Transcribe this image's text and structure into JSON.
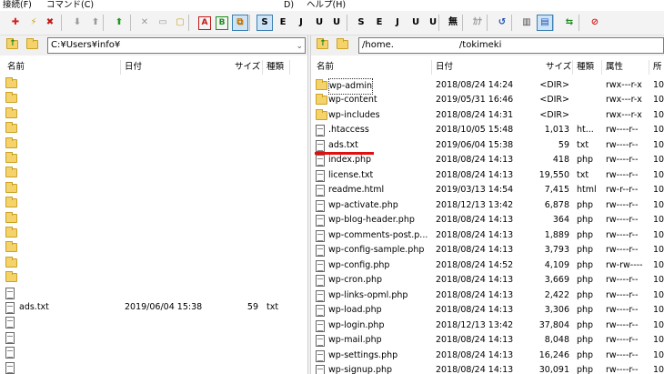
{
  "menu": {
    "items": [
      "接続(F)",
      "コマンド(C)",
      "D)",
      "ヘルプ(H)"
    ]
  },
  "toolbar": {
    "buttons": [
      {
        "icon": "connect-icon",
        "glyph": "✚",
        "color": "#d21f1f"
      },
      {
        "icon": "quick-connect-icon",
        "glyph": "⚡",
        "color": "#d4a000"
      },
      {
        "icon": "disconnect-icon",
        "glyph": "✖",
        "color": "#c01818"
      },
      {
        "icon": "download-icon",
        "glyph": "⬇",
        "color": "#9a9a9a"
      },
      {
        "icon": "upload-icon",
        "glyph": "⬆",
        "color": "#9a9a9a"
      },
      {
        "icon": "mirror-upload-icon",
        "glyph": "⬆",
        "color": "#1f9a1f"
      },
      {
        "icon": "delete-icon",
        "glyph": "✕",
        "color": "#9a9a9a"
      },
      {
        "icon": "rename-icon",
        "glyph": "▭",
        "color": "#9a9a9a"
      },
      {
        "icon": "mkdir-icon",
        "glyph": "▢",
        "color": "#c9a227"
      },
      {
        "icon": "ascii-mode-icon",
        "glyph": "A",
        "color": "#c01818"
      },
      {
        "icon": "binary-mode-icon",
        "glyph": "B",
        "color": "#1f8a1f"
      },
      {
        "icon": "auto-mode-icon",
        "glyph": "⧉",
        "color": "#c07000"
      },
      {
        "icon": "sjis-remote-icon",
        "glyph": "S",
        "color": "#000"
      },
      {
        "icon": "euc-remote-icon",
        "glyph": "E",
        "color": "#000"
      },
      {
        "icon": "jis-remote-icon",
        "glyph": "J",
        "color": "#000"
      },
      {
        "icon": "utf8n-remote-icon",
        "glyph": "U",
        "color": "#000"
      },
      {
        "icon": "utf8-remote-icon",
        "glyph": "U",
        "color": "#000"
      },
      {
        "icon": "sjis-local-icon",
        "glyph": "S",
        "color": "#000"
      },
      {
        "icon": "euc-local-icon",
        "glyph": "E",
        "color": "#000"
      },
      {
        "icon": "jis-local-icon",
        "glyph": "J",
        "color": "#000"
      },
      {
        "icon": "utf8n-local-icon",
        "glyph": "U",
        "color": "#000"
      },
      {
        "icon": "utf8-local-icon",
        "glyph": "U",
        "color": "#000"
      },
      {
        "icon": "no-convert-icon",
        "glyph": "無",
        "color": "#000"
      },
      {
        "icon": "kana-convert-icon",
        "glyph": "ｶﾅ",
        "color": "#9a9a9a"
      },
      {
        "icon": "refresh-icon",
        "glyph": "↺",
        "color": "#1f4fb0"
      },
      {
        "icon": "list-view-icon",
        "glyph": "▥",
        "color": "#444"
      },
      {
        "icon": "detail-view-icon",
        "glyph": "▤",
        "color": "#1f4fb0"
      },
      {
        "icon": "sync-folder-icon",
        "glyph": "⇆",
        "color": "#1f8a1f"
      },
      {
        "icon": "stop-icon",
        "glyph": "⊘",
        "color": "#d21f1f"
      }
    ]
  },
  "local": {
    "path": "C:¥Users¥info¥",
    "columns": [
      "名前",
      "日付",
      "サイズ",
      "種類"
    ],
    "rows": [
      {
        "type": "folder",
        "name": "",
        "date": "",
        "size": "",
        "kind": ""
      },
      {
        "type": "folder",
        "name": "",
        "date": "",
        "size": "",
        "kind": ""
      },
      {
        "type": "folder",
        "name": "",
        "date": "",
        "size": "",
        "kind": ""
      },
      {
        "type": "folder",
        "name": "",
        "date": "",
        "size": "",
        "kind": ""
      },
      {
        "type": "folder",
        "name": "",
        "date": "",
        "size": "",
        "kind": ""
      },
      {
        "type": "folder",
        "name": "",
        "date": "",
        "size": "",
        "kind": ""
      },
      {
        "type": "folder",
        "name": "",
        "date": "",
        "size": "",
        "kind": ""
      },
      {
        "type": "folder",
        "name": "",
        "date": "",
        "size": "",
        "kind": ""
      },
      {
        "type": "folder",
        "name": "",
        "date": "",
        "size": "",
        "kind": ""
      },
      {
        "type": "folder",
        "name": "",
        "date": "",
        "size": "",
        "kind": ""
      },
      {
        "type": "folder",
        "name": "",
        "date": "",
        "size": "",
        "kind": ""
      },
      {
        "type": "folder",
        "name": "",
        "date": "",
        "size": "",
        "kind": ""
      },
      {
        "type": "folder",
        "name": "",
        "date": "",
        "size": "",
        "kind": ""
      },
      {
        "type": "folder",
        "name": "",
        "date": "",
        "size": "",
        "kind": ""
      },
      {
        "type": "file",
        "name": "",
        "date": "",
        "size": "",
        "kind": ""
      },
      {
        "type": "file",
        "name": "ads.txt",
        "date": "2019/06/04 15:38",
        "size": "59",
        "kind": "txt"
      },
      {
        "type": "file",
        "name": "",
        "date": "",
        "size": "",
        "kind": ""
      },
      {
        "type": "file",
        "name": "",
        "date": "",
        "size": "",
        "kind": ""
      },
      {
        "type": "file",
        "name": "",
        "date": "",
        "size": "",
        "kind": ""
      },
      {
        "type": "file",
        "name": "",
        "date": "",
        "size": "",
        "kind": ""
      }
    ]
  },
  "remote": {
    "path_prefix": "/home.",
    "path_suffix": "/tokimeki",
    "columns": [
      "名前",
      "日付",
      "サイズ",
      "種類",
      "属性",
      "所"
    ],
    "rows": [
      {
        "type": "folder",
        "name": "wp-admin",
        "date": "2018/08/24 14:24",
        "size": "<DIR>",
        "kind": "",
        "attr": "rwx---r-x",
        "owner": "10"
      },
      {
        "type": "folder",
        "name": "wp-content",
        "date": "2019/05/31 16:46",
        "size": "<DIR>",
        "kind": "",
        "attr": "rwx---r-x",
        "owner": "10"
      },
      {
        "type": "folder",
        "name": "wp-includes",
        "date": "2018/08/24 14:31",
        "size": "<DIR>",
        "kind": "",
        "attr": "rwx---r-x",
        "owner": "10"
      },
      {
        "type": "file",
        "name": ".htaccess",
        "date": "2018/10/05 15:48",
        "size": "1,013",
        "kind": "ht...",
        "attr": "rw----r--",
        "owner": "10"
      },
      {
        "type": "file",
        "name": "ads.txt",
        "date": "2019/06/04 15:38",
        "size": "59",
        "kind": "txt",
        "attr": "rw----r--",
        "owner": "10"
      },
      {
        "type": "file",
        "name": "index.php",
        "date": "2018/08/24 14:13",
        "size": "418",
        "kind": "php",
        "attr": "rw----r--",
        "owner": "10"
      },
      {
        "type": "file",
        "name": "license.txt",
        "date": "2018/08/24 14:13",
        "size": "19,550",
        "kind": "txt",
        "attr": "rw----r--",
        "owner": "10"
      },
      {
        "type": "file",
        "name": "readme.html",
        "date": "2019/03/13 14:54",
        "size": "7,415",
        "kind": "html",
        "attr": "rw-r--r--",
        "owner": "10"
      },
      {
        "type": "file",
        "name": "wp-activate.php",
        "date": "2018/12/13 13:42",
        "size": "6,878",
        "kind": "php",
        "attr": "rw----r--",
        "owner": "10"
      },
      {
        "type": "file",
        "name": "wp-blog-header.php",
        "date": "2018/08/24 14:13",
        "size": "364",
        "kind": "php",
        "attr": "rw----r--",
        "owner": "10"
      },
      {
        "type": "file",
        "name": "wp-comments-post.p...",
        "date": "2018/08/24 14:13",
        "size": "1,889",
        "kind": "php",
        "attr": "rw----r--",
        "owner": "10"
      },
      {
        "type": "file",
        "name": "wp-config-sample.php",
        "date": "2018/08/24 14:13",
        "size": "3,793",
        "kind": "php",
        "attr": "rw----r--",
        "owner": "10"
      },
      {
        "type": "file",
        "name": "wp-config.php",
        "date": "2018/08/24 14:52",
        "size": "4,109",
        "kind": "php",
        "attr": "rw-rw----",
        "owner": "10"
      },
      {
        "type": "file",
        "name": "wp-cron.php",
        "date": "2018/08/24 14:13",
        "size": "3,669",
        "kind": "php",
        "attr": "rw----r--",
        "owner": "10"
      },
      {
        "type": "file",
        "name": "wp-links-opml.php",
        "date": "2018/08/24 14:13",
        "size": "2,422",
        "kind": "php",
        "attr": "rw----r--",
        "owner": "10"
      },
      {
        "type": "file",
        "name": "wp-load.php",
        "date": "2018/08/24 14:13",
        "size": "3,306",
        "kind": "php",
        "attr": "rw----r--",
        "owner": "10"
      },
      {
        "type": "file",
        "name": "wp-login.php",
        "date": "2018/12/13 13:42",
        "size": "37,804",
        "kind": "php",
        "attr": "rw----r--",
        "owner": "10"
      },
      {
        "type": "file",
        "name": "wp-mail.php",
        "date": "2018/08/24 14:13",
        "size": "8,048",
        "kind": "php",
        "attr": "rw----r--",
        "owner": "10"
      },
      {
        "type": "file",
        "name": "wp-settings.php",
        "date": "2018/08/24 14:13",
        "size": "16,246",
        "kind": "php",
        "attr": "rw----r--",
        "owner": "10"
      },
      {
        "type": "file",
        "name": "wp-signup.php",
        "date": "2018/08/24 14:13",
        "size": "30,091",
        "kind": "php",
        "attr": "rw----r--",
        "owner": "10"
      }
    ]
  },
  "colors": {
    "highlight_underline": "#e01010",
    "folder": "#f5d36a"
  }
}
